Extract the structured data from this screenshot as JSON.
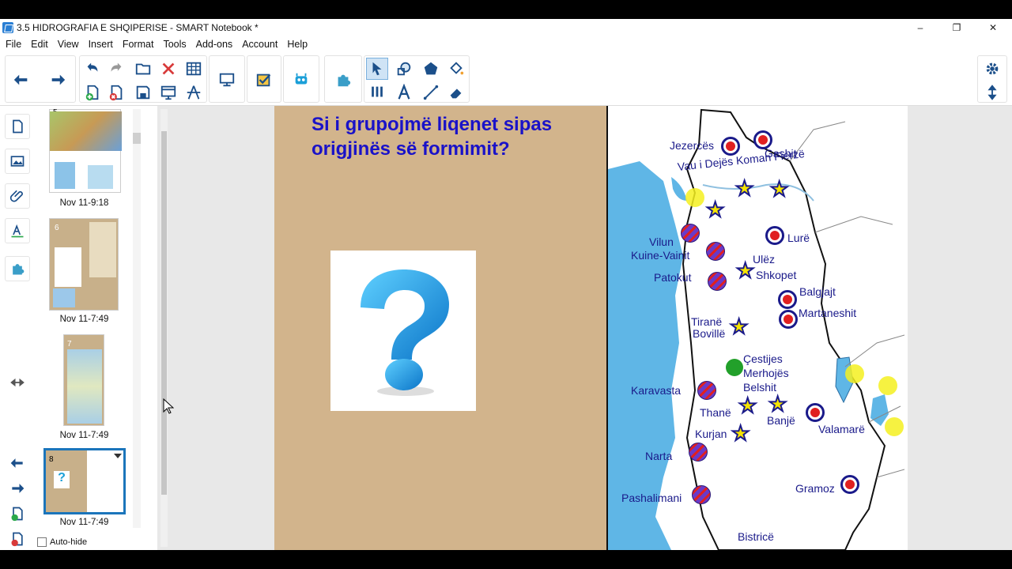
{
  "window": {
    "title": "3.5 HIDROGRAFIA E SHQIPERISE - SMART Notebook *",
    "minimize": "–",
    "maximize": "❐",
    "close": "✕"
  },
  "menu": [
    "File",
    "Edit",
    "View",
    "Insert",
    "Format",
    "Tools",
    "Add-ons",
    "Account",
    "Help"
  ],
  "sorter": {
    "slides": [
      {
        "number": "5",
        "date": "Nov 11-9:18"
      },
      {
        "number": "6",
        "date": "Nov 11-7:49"
      },
      {
        "number": "7",
        "date": "Nov 11-7:49"
      },
      {
        "number": "8",
        "date": "Nov 11-7:49"
      }
    ],
    "autohide_label": "Auto-hide"
  },
  "page": {
    "heading_line1": "Si i grupojmë liqenet sipas",
    "heading_line2": "origjinës së formimit?"
  },
  "map": {
    "labels": {
      "jezerce": "Jezercës",
      "gashit": "Gashit",
      "vau": "Vau i Dejës Koman Fierzë",
      "vilun": "Vilun",
      "kuine": "Kuine-Vainit",
      "lure": "Lurë",
      "ulez": "Ulëz",
      "shkopet": "Shkopet",
      "patokut": "Patokut",
      "balgjajt": "Balgjajt",
      "martaneshit": "Martaneshit",
      "tirane": "Tiranë",
      "boville": "Bovillë",
      "cestijes": "Çestijes",
      "merhojes": "Merhojës",
      "belshit": "Belshit",
      "karavasta": "Karavasta",
      "thane": "Thanë",
      "banje": "Banjë",
      "valamare": "Valamarë",
      "kurjan": "Kurjan",
      "narta": "Narta",
      "pashalimani": "Pashalimani",
      "gramoz": "Gramoz",
      "bistrice": "Bistricë"
    }
  },
  "colors": {
    "heading": "#1a12c8",
    "page_bg": "#d2b48c",
    "sea": "#5fb6e6",
    "accent": "#1b75bb"
  }
}
